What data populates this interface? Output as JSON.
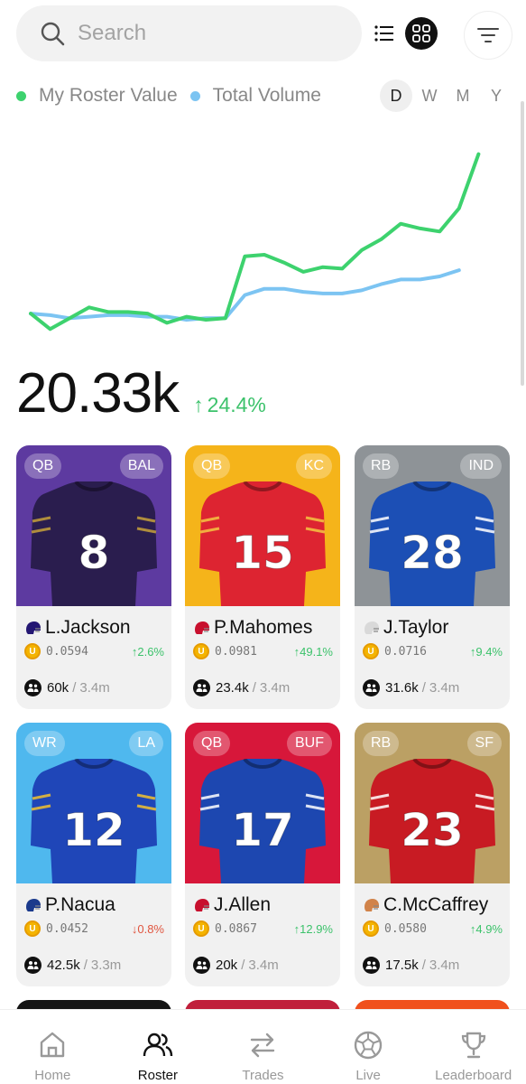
{
  "search": {
    "placeholder": "Search"
  },
  "legend": {
    "roster_label": "My Roster Value",
    "volume_label": "Total Volume",
    "roster_color": "#3dd26e",
    "volume_color": "#7cc4f2"
  },
  "ranges": [
    "D",
    "W",
    "M",
    "Y"
  ],
  "active_range": "D",
  "chart_data": {
    "type": "line",
    "x": [
      0,
      1,
      2,
      3,
      4,
      5,
      6,
      7,
      8,
      9,
      10,
      11,
      12,
      13,
      14,
      15,
      16,
      17,
      18,
      19,
      20,
      21,
      22,
      23,
      24
    ],
    "series": [
      {
        "name": "My Roster Value",
        "color": "#3dd26e",
        "values": [
          25,
          15,
          22,
          29,
          26,
          26,
          25,
          19,
          23,
          21,
          22,
          62,
          63,
          58,
          52,
          55,
          54,
          66,
          73,
          83,
          80,
          78,
          93,
          128
        ]
      },
      {
        "name": "Total Volume",
        "color": "#7cc4f2",
        "values": [
          25,
          24,
          22,
          23,
          24,
          24,
          23,
          23,
          21,
          22,
          22,
          37,
          41,
          41,
          39,
          38,
          38,
          40,
          44,
          47,
          47,
          49,
          53
        ]
      }
    ],
    "ylim": [
      0,
      140
    ],
    "grid": false,
    "legend": "top-left"
  },
  "portfolio": {
    "value": "20.33k",
    "change": "24.4%"
  },
  "cards": [
    {
      "pos": "QB",
      "team": "BAL",
      "name": "L.Jackson",
      "number": "8",
      "bg": "#5d3aa0",
      "jersey": "#2a1d4e",
      "accent": "#c7a13b",
      "helmet": "#241773",
      "price": "0.0594",
      "change": "2.6%",
      "dir": "up",
      "holders": "60k",
      "supply": "3.4m"
    },
    {
      "pos": "QB",
      "team": "KC",
      "name": "P.Mahomes",
      "number": "15",
      "bg": "#f5b41a",
      "jersey": "#dd2431",
      "accent": "#f5c542",
      "helmet": "#c8102e",
      "price": "0.0981",
      "change": "49.1%",
      "dir": "up",
      "holders": "23.4k",
      "supply": "3.4m"
    },
    {
      "pos": "RB",
      "team": "IND",
      "name": "J.Taylor",
      "number": "28",
      "bg": "#8e9397",
      "jersey": "#1c4fb5",
      "accent": "#ffffff",
      "helmet": "#d9d9d9",
      "price": "0.0716",
      "change": "9.4%",
      "dir": "up",
      "holders": "31.6k",
      "supply": "3.4m"
    },
    {
      "pos": "WR",
      "team": "LA",
      "name": "P.Nacua",
      "number": "12",
      "bg": "#4fb8ee",
      "jersey": "#1f46b8",
      "accent": "#f2c230",
      "helmet": "#1b3a8c",
      "price": "0.0452",
      "change": "0.8%",
      "dir": "down",
      "holders": "42.5k",
      "supply": "3.3m"
    },
    {
      "pos": "QB",
      "team": "BUF",
      "name": "J.Allen",
      "number": "17",
      "bg": "#d7173a",
      "jersey": "#1d47b0",
      "accent": "#ffffff",
      "helmet": "#c8102e",
      "price": "0.0867",
      "change": "12.9%",
      "dir": "up",
      "holders": "20k",
      "supply": "3.4m"
    },
    {
      "pos": "RB",
      "team": "SF",
      "name": "C.McCaffrey",
      "number": "23",
      "bg": "#bba064",
      "jersey": "#c81b23",
      "accent": "#ffffff",
      "helmet": "#d1834a",
      "price": "0.0580",
      "change": "4.9%",
      "dir": "up",
      "holders": "17.5k",
      "supply": "3.4m"
    }
  ],
  "peek_colors": [
    "#151515",
    "#c01f3b",
    "#f0501d"
  ],
  "nav": [
    {
      "label": "Home",
      "icon": "home-icon",
      "active": false
    },
    {
      "label": "Roster",
      "icon": "users-icon",
      "active": true
    },
    {
      "label": "Trades",
      "icon": "swap-icon",
      "active": false
    },
    {
      "label": "Live",
      "icon": "ball-icon",
      "active": false
    },
    {
      "label": "Leaderboard",
      "icon": "trophy-icon",
      "active": false
    }
  ]
}
